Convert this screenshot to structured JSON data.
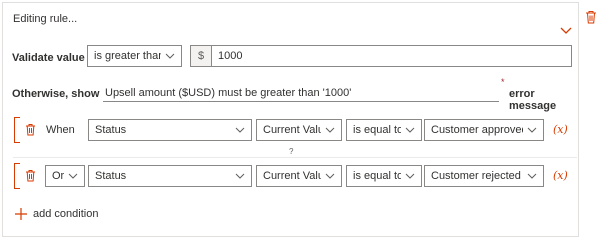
{
  "rule": {
    "title": "Editing rule...",
    "validate_label": "Validate value",
    "operator": "is greater than",
    "currency_prefix": "$",
    "value": "1000",
    "otherwise_label": "Otherwise, show",
    "error_text": "Upsell amount ($USD) must be greater than '1000'",
    "error_suffix": "error message",
    "required_mark": "*"
  },
  "conditions": [
    {
      "joiner": "When",
      "field": "Status",
      "source": "Current Value",
      "comparator": "is equal to",
      "target": "Customer approved",
      "formula": "(x)"
    },
    {
      "joiner": "Or",
      "field": "Status",
      "source": "Current Value",
      "comparator": "is equal to",
      "target": "Customer rejected",
      "formula": "(x)"
    }
  ],
  "hint": "?",
  "add_condition_label": "add condition",
  "colors": {
    "accent": "#d83b01",
    "border": "#8a8886"
  },
  "icons": [
    "trash-icon",
    "chevron-down-icon",
    "plus-icon",
    "formula-icon"
  ]
}
